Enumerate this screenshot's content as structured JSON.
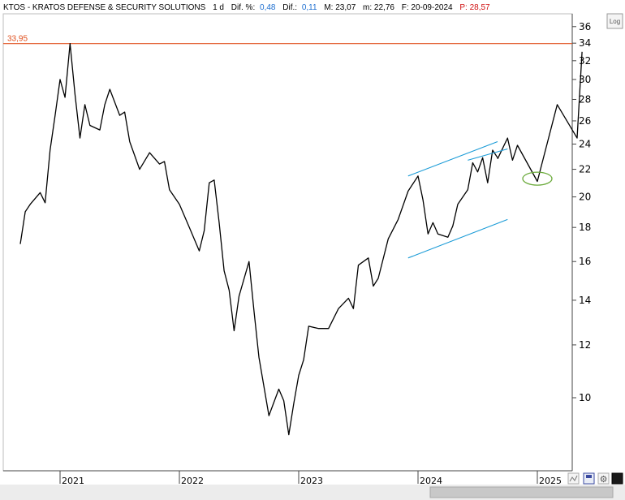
{
  "header": {
    "symbol_name": "KTOS - KRATOS DEFENSE & SECURITY SOLUTIONS",
    "period": "1 d",
    "dif_pct_label": "Dif. %:",
    "dif_pct_value": "0,48",
    "dif_label": "Dif.:",
    "dif_value": "0,11",
    "max": "M: 23,07",
    "min": "m: 22,76",
    "date": "F: 20-09-2024",
    "price": "P: 28,57"
  },
  "controls": {
    "log_label": "Log"
  },
  "colors": {
    "price": "#000000",
    "channel": "#1a9bd7",
    "resistance": "#e0501e",
    "target_ellipse": "#6aaa3a",
    "value_blue": "#1e6fd0",
    "value_red": "#d01010"
  },
  "chart_data": {
    "type": "line",
    "scale": "log",
    "ylim": [
      8.5,
      37
    ],
    "y_ticks": [
      "36",
      "34",
      "32",
      "30",
      "28",
      "26",
      "24",
      "22",
      "20",
      "18",
      "16",
      "14",
      "12",
      "10"
    ],
    "x_ticks": [
      "2021",
      "2022",
      "2023",
      "2024",
      "2025"
    ],
    "resistance_label": "33,95",
    "resistance_value": 33.95,
    "series": [
      {
        "points": [
          [
            "2020-09",
            17.0
          ],
          [
            "2020-09",
            19.0
          ],
          [
            "2020-10",
            19.5
          ],
          [
            "2020-11",
            20.3
          ],
          [
            "2020-11",
            19.6
          ],
          [
            "2020-12",
            23.5
          ],
          [
            "2020-12",
            26.5
          ],
          [
            "2021-01",
            30.0
          ],
          [
            "2021-01",
            28.2
          ],
          [
            "2021-02",
            33.95
          ],
          [
            "2021-02",
            28.5
          ],
          [
            "2021-03",
            24.5
          ],
          [
            "2021-03",
            27.5
          ],
          [
            "2021-04",
            25.6
          ],
          [
            "2021-05",
            25.2
          ],
          [
            "2021-05",
            27.5
          ],
          [
            "2021-06",
            29.0
          ],
          [
            "2021-07",
            26.5
          ],
          [
            "2021-07",
            26.8
          ],
          [
            "2021-08",
            24.2
          ],
          [
            "2021-09",
            22.0
          ],
          [
            "2021-10",
            23.3
          ],
          [
            "2021-11",
            22.4
          ],
          [
            "2021-11",
            22.6
          ],
          [
            "2021-12",
            20.5
          ],
          [
            "2022-01",
            19.5
          ],
          [
            "2022-02",
            18.0
          ],
          [
            "2022-03",
            16.6
          ],
          [
            "2022-03",
            17.8
          ],
          [
            "2022-04",
            21.0
          ],
          [
            "2022-04",
            21.2
          ],
          [
            "2022-05",
            18.3
          ],
          [
            "2022-05",
            15.5
          ],
          [
            "2022-06",
            14.5
          ],
          [
            "2022-06",
            12.6
          ],
          [
            "2022-07",
            14.2
          ],
          [
            "2022-08",
            16.0
          ],
          [
            "2022-08",
            13.5
          ],
          [
            "2022-09",
            11.5
          ],
          [
            "2022-10",
            9.4
          ],
          [
            "2022-11",
            10.3
          ],
          [
            "2022-11",
            9.9
          ],
          [
            "2022-12",
            8.8
          ],
          [
            "2022-12",
            9.8
          ],
          [
            "2023-01",
            10.8
          ],
          [
            "2023-01",
            11.4
          ],
          [
            "2023-02",
            12.8
          ],
          [
            "2023-03",
            12.7
          ],
          [
            "2023-04",
            12.7
          ],
          [
            "2023-05",
            13.6
          ],
          [
            "2023-06",
            14.1
          ],
          [
            "2023-06",
            13.6
          ],
          [
            "2023-07",
            15.8
          ],
          [
            "2023-08",
            16.2
          ],
          [
            "2023-08",
            14.7
          ],
          [
            "2023-09",
            15.1
          ],
          [
            "2023-10",
            17.3
          ],
          [
            "2023-11",
            18.5
          ],
          [
            "2023-12",
            20.4
          ],
          [
            "2024-01",
            21.5
          ],
          [
            "2024-01",
            19.8
          ],
          [
            "2024-02",
            17.6
          ],
          [
            "2024-02",
            18.3
          ],
          [
            "2024-03",
            17.6
          ],
          [
            "2024-04",
            17.4
          ],
          [
            "2024-04",
            18.1
          ],
          [
            "2024-05",
            19.5
          ],
          [
            "2024-06",
            20.5
          ],
          [
            "2024-06",
            22.5
          ],
          [
            "2024-07",
            21.8
          ],
          [
            "2024-07",
            22.9
          ],
          [
            "2024-08",
            21.0
          ],
          [
            "2024-08",
            23.5
          ],
          [
            "2024-09",
            22.9
          ]
        ]
      },
      {
        "points": [
          [
            "2024-09",
            22.8
          ],
          [
            "2024-10",
            24.5
          ],
          [
            "2024-10",
            22.7
          ],
          [
            "2024-11",
            23.9
          ],
          [
            "2025-01",
            21.1
          ],
          [
            "2025-03",
            27.5
          ],
          [
            "2025-05",
            24.5
          ],
          [
            "2025-05",
            33.0
          ]
        ]
      },
      {
        "points": [
          [
            "2023-12",
            21.5
          ],
          [
            "2024-09",
            24.2
          ]
        ]
      },
      {
        "points": [
          [
            "2023-12",
            16.2
          ],
          [
            "2024-10",
            18.5
          ]
        ]
      },
      {
        "points": [
          [
            "2024-06",
            22.7
          ],
          [
            "2024-10",
            23.6
          ]
        ]
      }
    ],
    "target_zone": {
      "x": "2025-01",
      "y": 21.3
    }
  }
}
